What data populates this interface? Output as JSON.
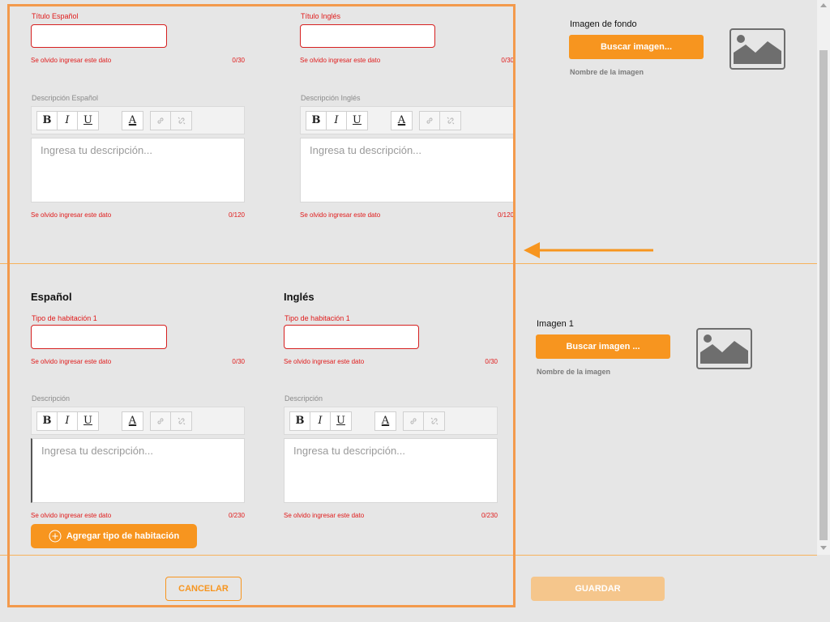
{
  "top": {
    "left": {
      "title_label": "Título Español",
      "title_error": "Se olvido ingresar este dato",
      "title_count": "0/30",
      "desc_label": "Descripción Español",
      "desc_placeholder": "Ingresa tu descripción...",
      "desc_error": "Se olvido ingresar este dato",
      "desc_count": "0/120"
    },
    "right": {
      "title_label": "Título Inglés",
      "title_error": "Se olvido ingresar este dato",
      "title_count": "0/30",
      "desc_label": "Descripción Inglés",
      "desc_placeholder": "Ingresa tu descripción...",
      "desc_error": "Se olvido ingresar este dato",
      "desc_count": "0/120"
    },
    "image": {
      "label": "Imagen de fondo",
      "button": "Buscar imagen...",
      "filename": "Nombre de la imagen"
    }
  },
  "rooms": {
    "left": {
      "heading": "Español",
      "type_label": "Tipo de habitación 1",
      "type_error": "Se olvido ingresar este dato",
      "type_count": "0/30",
      "desc_label": "Descripción",
      "desc_placeholder": "Ingresa tu descripción...",
      "desc_error": "Se olvido ingresar este dato",
      "desc_count": "0/230"
    },
    "right": {
      "heading": "Inglés",
      "type_label": "Tipo de habitación 1",
      "type_error": "Se olvido ingresar este dato",
      "type_count": "0/30",
      "desc_label": "Descripción",
      "desc_placeholder": "Ingresa tu descripción...",
      "desc_error": "Se olvido ingresar este dato",
      "desc_count": "0/230"
    },
    "image": {
      "label": "Imagen 1",
      "button": "Buscar imagen ...",
      "filename": "Nombre de la imagen"
    },
    "add_button": "Agregar tipo de habitación"
  },
  "toolbar": {
    "bold": "B",
    "italic": "I",
    "underline": "U",
    "color": "A"
  },
  "footer": {
    "cancel": "CANCELAR",
    "save": "GUARDAR"
  },
  "colors": {
    "accent": "#f7951f",
    "error": "#e01b1b",
    "background": "#e6e6e6"
  },
  "icons": [
    "bold-icon",
    "italic-icon",
    "underline-icon",
    "text-color-icon",
    "link-icon",
    "unlink-icon",
    "image-placeholder-icon",
    "plus-circle-icon",
    "arrow-left-icon"
  ]
}
